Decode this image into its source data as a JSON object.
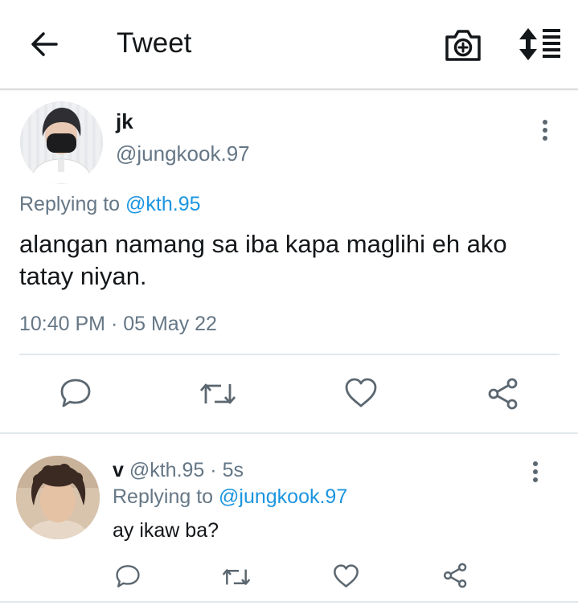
{
  "header": {
    "title": "Tweet",
    "back_icon": "arrow-left-icon",
    "camera_icon": "camera-plus-icon",
    "sort_icon": "sort-list-icon"
  },
  "main_tweet": {
    "name": "jk",
    "handle": "@jungkook.97",
    "replying_prefix": "Replying to",
    "replying_handle": "@kth.95",
    "text": "alangan namang sa iba kapa maglihi eh ako tatay niyan.",
    "timestamp": "10:40 PM · 05 May 22"
  },
  "reply_tweet": {
    "name": "v",
    "handle": "@kth.95",
    "separator": "·",
    "age": "5s",
    "replying_prefix": "Replying to",
    "replying_handle": "@jungkook.97",
    "text": "ay ikaw ba?"
  },
  "colors": {
    "link": "#1b95e0",
    "muted": "#657786",
    "text": "#14171a",
    "divider": "#e1e8ed"
  }
}
